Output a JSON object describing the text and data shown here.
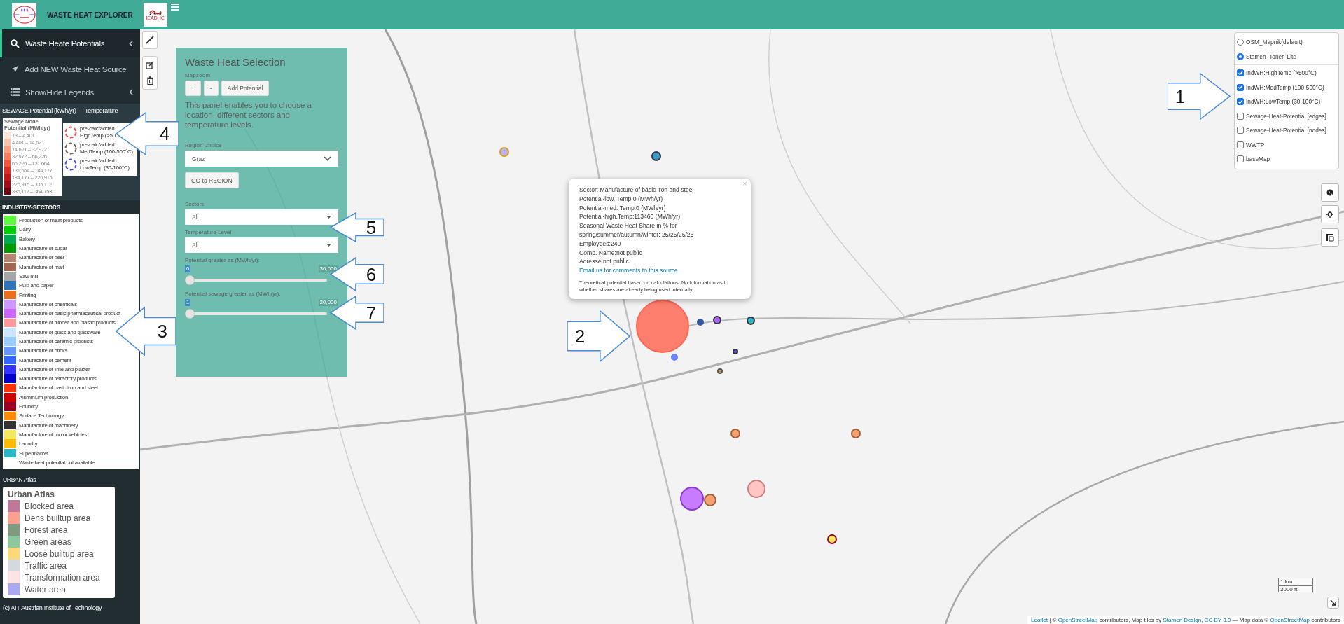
{
  "header": {
    "title": "WASTE HEAT EXPLORER",
    "partner_logo_text": "IEADHC"
  },
  "sidebar": {
    "menu": [
      {
        "label": "Waste Heate Potentials",
        "selected": true,
        "chevron": true
      },
      {
        "label": "Add NEW Waste Heat Source",
        "selected": false,
        "chevron": false
      },
      {
        "label": "Show/Hide Legends",
        "selected": false,
        "chevron": true
      }
    ],
    "sewage_heading": "SEWAGE Potential (kWh/yr) --- Temperature",
    "sewage_legend": {
      "title": "Sewage Node Potential (MWh/yr)",
      "classes": [
        {
          "range": "73 – 4,401",
          "color": "#fee5d9"
        },
        {
          "range": "4,401 – 14,621",
          "color": "#fcc5ab"
        },
        {
          "range": "14,621 – 32,972",
          "color": "#fca082"
        },
        {
          "range": "32,972 – 66,226",
          "color": "#fb7b5c"
        },
        {
          "range": "66,226 – 131,664",
          "color": "#f4533d"
        },
        {
          "range": "131,664 – 184,177",
          "color": "#e02d25"
        },
        {
          "range": "184,177 – 226,915",
          "color": "#c4161b"
        },
        {
          "range": "226,915 – 335,112",
          "color": "#a10e16"
        },
        {
          "range": "335,112 – 364,753",
          "color": "#6f0610"
        }
      ]
    },
    "temperature_legend": [
      {
        "line1": "pre-calc/added",
        "line2": "HighTemp (>50",
        "color": "#f05050"
      },
      {
        "line1": "pre-calc/added",
        "line2": "MedTemp (100-500°C)",
        "color": "#7a6050"
      },
      {
        "line1": "pre-calc/added",
        "line2": "LowTemp (30-100°C)",
        "color": "#4a4ae0"
      }
    ],
    "industry_heading": "INDUSTRY-SECTORS",
    "industry_sectors": [
      {
        "label": "Production of meat products",
        "color": "#5dfc3c"
      },
      {
        "label": "Dairy",
        "color": "#00cc00"
      },
      {
        "label": "Bakery",
        "color": "#00aa55"
      },
      {
        "label": "Manufacture of sugar",
        "color": "#009900"
      },
      {
        "label": "Manufacture of beer",
        "color": "#b48470"
      },
      {
        "label": "Manufacture of malt",
        "color": "#a0654a"
      },
      {
        "label": "Saw mill",
        "color": "#a6a6a6"
      },
      {
        "label": "Pulp and paper",
        "color": "#2e74b8"
      },
      {
        "label": "Printing",
        "color": "#ec6d1c"
      },
      {
        "label": "Manufacture of chemicals",
        "color": "#cc99ff"
      },
      {
        "label": "Manufacture of basic pharmaceutical product",
        "color": "#cc66ff"
      },
      {
        "label": "Manufacture of rubber and plastic products",
        "color": "#ff9999"
      },
      {
        "label": "Manufacture of glass and glassware",
        "color": "#cce6ff"
      },
      {
        "label": "Manufacture of ceramic products",
        "color": "#99ccff"
      },
      {
        "label": "Manufacture of bricks",
        "color": "#6699ff"
      },
      {
        "label": "Manufacture of cement",
        "color": "#3366ff"
      },
      {
        "label": "Manufacture of lime and plaster",
        "color": "#3333ff"
      },
      {
        "label": "Manufacture of refractory products",
        "color": "#0000cc"
      },
      {
        "label": "Manufacture of basic iron and steel",
        "color": "#ff3300"
      },
      {
        "label": "Aluminium production",
        "color": "#cc0000"
      },
      {
        "label": "Foundry",
        "color": "#990022"
      },
      {
        "label": "Surface Technology",
        "color": "#ff8c00"
      },
      {
        "label": "Manufacture of machinery",
        "color": "#333333"
      },
      {
        "label": "Manufacture of motor vehicles",
        "color": "#f2ea5c"
      },
      {
        "label": "Laundry",
        "color": "#ffbb00"
      },
      {
        "label": "Supermarket",
        "color": "#2ab8c8"
      },
      {
        "label": "Waste heat potential not available"
      }
    ],
    "urban_heading": "URBAN Atlas",
    "urban_legend": {
      "title": "Urban Atlas",
      "classes": [
        {
          "label": "Blocked area",
          "color": "#c0789a"
        },
        {
          "label": "Dens builtup area",
          "color": "#fba08c"
        },
        {
          "label": "Forest area",
          "color": "#7f9a80"
        },
        {
          "label": "Green areas",
          "color": "#8cc89c"
        },
        {
          "label": "Loose builtup area",
          "color": "#fcd877"
        },
        {
          "label": "Traffic area",
          "color": "#d5d8dc"
        },
        {
          "label": "Transformation area",
          "color": "#fde4e4"
        },
        {
          "label": "Water area",
          "color": "#a9a9f2"
        }
      ]
    },
    "copyright": "(c) AIT Austrian Institute of Technology"
  },
  "map": {
    "selection_panel": {
      "title": "Waste Heat Selection",
      "mapzoom_label": "Mapzoom",
      "buttons": [
        "+",
        "-",
        "Add Potential"
      ],
      "description": "This panel enables you to choose a location, different sectors and temperature levels.",
      "region_label": "Region Choice",
      "region_value": "Graz",
      "go_button": "GO to REGION",
      "sectors_label": "Sectors",
      "sectors_value": "All",
      "temperature_label": "Temperature Level",
      "temperature_value": "All",
      "sliders": [
        {
          "label": "Potential greater as (MWh/yr):",
          "min": "0",
          "max": "30,000",
          "level": 0
        },
        {
          "label": "Potential sewage greater as (MWh/yr):",
          "min": "1",
          "max": "20,000",
          "level": 0
        }
      ]
    },
    "popup": {
      "close": "×",
      "lines": [
        "Sector: Manufacture of basic iron and steel",
        "Potential-low. Temp:0 (MWh/yr)",
        "Potential-med. Temp:0 (MWh/yr)",
        "Potential-high.Temp:113460 (MWh/yr)",
        "Seasonal Waste Heat Share in % for spring/summer/autumn/winter: 25/25/25/25",
        "Employees:240",
        "Comp. Name:not public",
        "Adresse:not public"
      ],
      "link": "Email us for comments to this source",
      "note": "Theoretical potential based on calculations. No information as to whether shares are already being used internally"
    },
    "base_layers": [
      {
        "label": "OSM_Mapnik(default)",
        "selected": false
      },
      {
        "label": "Stamen_Toner_Lite",
        "selected": true
      }
    ],
    "overlays": [
      {
        "label": "IndWH:HighTemp (>500°C)",
        "checked": true
      },
      {
        "label": "IndWH:MedTemp (100-500°C)",
        "checked": true
      },
      {
        "label": "IndWH:LowTemp (30-100°C)",
        "checked": true
      },
      {
        "label": "Sewage-Heat-Potential [edges]",
        "checked": false
      },
      {
        "label": "Sewage-Heat-Potential [nodes]",
        "checked": false
      },
      {
        "label": "WWTP",
        "checked": false
      },
      {
        "label": "baseMap",
        "checked": false
      }
    ],
    "scale": [
      "1 km",
      "3000 ft"
    ],
    "attribution": [
      {
        "text": "Leaflet",
        "kind": "link"
      },
      {
        "text": " | © ",
        "kind": "text"
      },
      {
        "text": "OpenStreetMap",
        "kind": "link"
      },
      {
        "text": " contributors, Map tiles by ",
        "kind": "text"
      },
      {
        "text": "Stamen Design",
        "kind": "link"
      },
      {
        "text": ", ",
        "kind": "text"
      },
      {
        "text": "CC BY 3.0",
        "kind": "link"
      },
      {
        "text": " — Map data © ",
        "kind": "text"
      },
      {
        "text": "OpenStreetMap",
        "kind": "link"
      },
      {
        "text": " contributors",
        "kind": "text"
      }
    ]
  },
  "callouts": [
    {
      "label": "1"
    },
    {
      "label": "2"
    },
    {
      "label": "3"
    },
    {
      "label": "4"
    },
    {
      "label": "5"
    },
    {
      "label": "6"
    },
    {
      "label": "7"
    }
  ]
}
